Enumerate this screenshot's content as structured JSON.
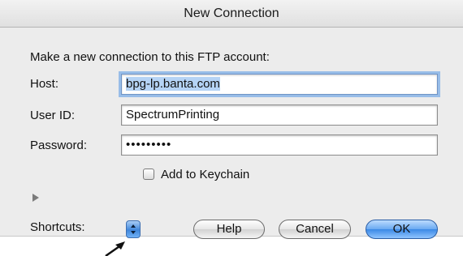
{
  "window": {
    "title": "New Connection"
  },
  "form": {
    "instructions": "Make a new connection to this FTP account:",
    "host": {
      "label": "Host:",
      "value": "bpg-lp.banta.com"
    },
    "user_id": {
      "label": "User ID:",
      "value": "SpectrumPrinting"
    },
    "password": {
      "label": "Password:",
      "value": "•••••••••"
    },
    "keychain": {
      "label": "Add to Keychain",
      "checked": false
    }
  },
  "footer": {
    "shortcuts_label": "Shortcuts:",
    "help_label": "Help",
    "cancel_label": "Cancel",
    "ok_label": "OK"
  },
  "colors": {
    "focus_ring": "#98bde8",
    "selection": "#b5d3f5",
    "default_button": "#3b89e6"
  },
  "icons": {
    "disclosure": "disclosure-triangle-icon",
    "stepper": "stepper-arrows-icon",
    "pointer": "arrow-pointer-icon"
  }
}
